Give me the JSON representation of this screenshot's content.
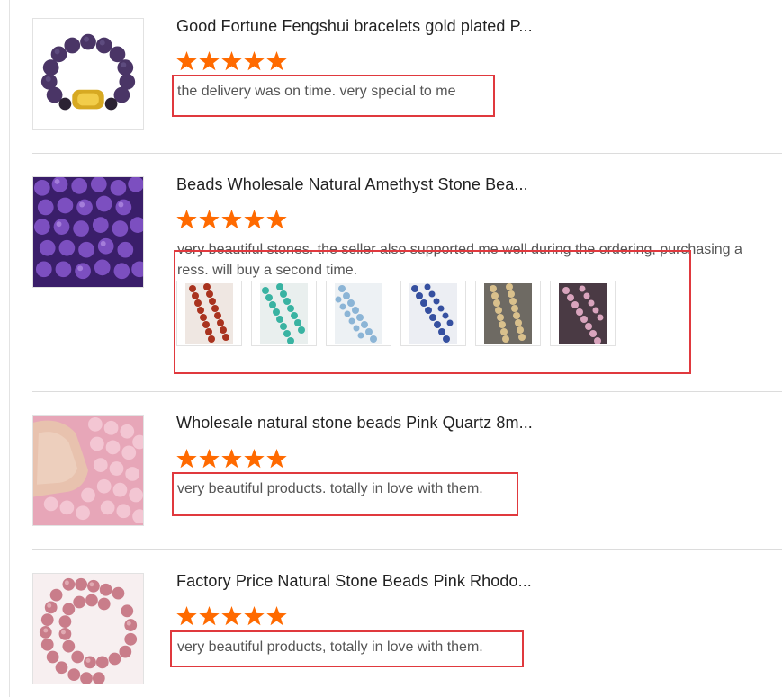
{
  "reviews": [
    {
      "title": "Good Fortune Fengshui bracelets gold plated P...",
      "rating": 5,
      "comment": "the delivery was on time. very  special to me",
      "thumbnail": "amethyst-bracelet-image"
    },
    {
      "title": "Beads Wholesale Natural Amethyst Stone Bea...",
      "rating": 5,
      "comment_line1": "very beautiful stones. the seller also supported me well during the ordering, purchasing a",
      "comment_line2": "ress. will buy a second time.",
      "thumbnail": "amethyst-beads-image",
      "photos": [
        {
          "name": "red-beads-photo",
          "color": "#a9331f"
        },
        {
          "name": "turquoise-beads-photo",
          "color": "#39b3a2"
        },
        {
          "name": "light-blue-beads-photo",
          "color": "#8cb5d6"
        },
        {
          "name": "dark-blue-beads-photo",
          "color": "#3650a0"
        },
        {
          "name": "beige-beads-photo",
          "color": "#d9c08c"
        },
        {
          "name": "pink-beads-photo",
          "color": "#d9a4bd"
        }
      ]
    },
    {
      "title": "Wholesale natural stone beads Pink Quartz 8m...",
      "rating": 5,
      "comment": "very beautiful products. totally in love with them.",
      "thumbnail": "pink-quartz-beads-image"
    },
    {
      "title": "Factory Price Natural Stone Beads Pink Rhodo...",
      "rating": 5,
      "comment": "very beautiful products, totally in love with them.",
      "thumbnail": "pink-rhodonite-beads-image"
    }
  ],
  "colors": {
    "star": "#ff6a00",
    "highlight": "#e0393e",
    "title": "#222222",
    "comment": "#555555",
    "divider": "#dcdcdc"
  }
}
